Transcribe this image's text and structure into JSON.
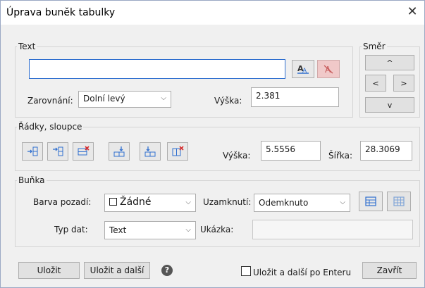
{
  "window": {
    "title": "Úprava buněk tabulky"
  },
  "text_group": {
    "legend": "Text",
    "input_value": "",
    "align_label": "Zarovnání:",
    "align_value": "Dolní levý",
    "height_label": "Výška:",
    "height_value": "2.381"
  },
  "direction_group": {
    "legend": "Směr",
    "up": "^",
    "left": "<",
    "right": ">",
    "down": "v"
  },
  "rows_group": {
    "legend": "Řádky, sloupce",
    "height_label": "Výška:",
    "height_value": "5.5556",
    "width_label": "Šířka:",
    "width_value": "28.3069"
  },
  "cell_group": {
    "legend": "Buňka",
    "bg_label": "Barva pozadí:",
    "bg_value": "Žádné",
    "lock_label": "Uzamknutí:",
    "lock_value": "Odemknuto",
    "type_label": "Typ dat:",
    "type_value": "Text",
    "preview_label": "Ukázka:",
    "preview_value": ""
  },
  "footer": {
    "save": "Uložit",
    "save_next": "Uložit a další",
    "enter_check_label": "Uložit a další po Enteru",
    "close": "Zavřít"
  }
}
